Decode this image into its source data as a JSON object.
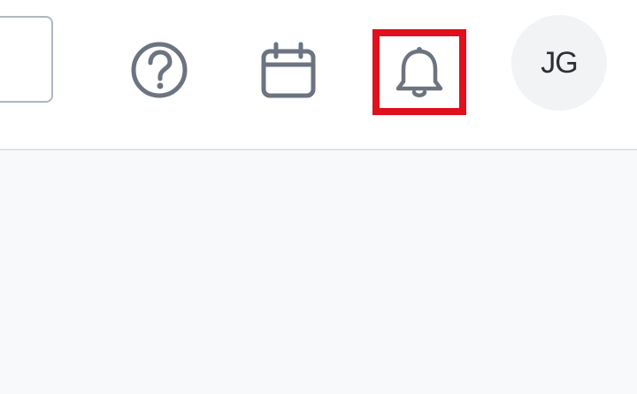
{
  "header": {
    "search": {
      "value": "",
      "placeholder": ""
    },
    "icons": {
      "help": "help-circle-icon",
      "calendar": "calendar-icon",
      "notifications": "bell-icon"
    },
    "user": {
      "initials": "JG"
    }
  },
  "colors": {
    "icon": "#6b7480",
    "highlight": "#e0101c",
    "divider": "#dde2e8",
    "avatar_bg": "#f1f3f5",
    "content_bg": "#f8f9fa"
  }
}
